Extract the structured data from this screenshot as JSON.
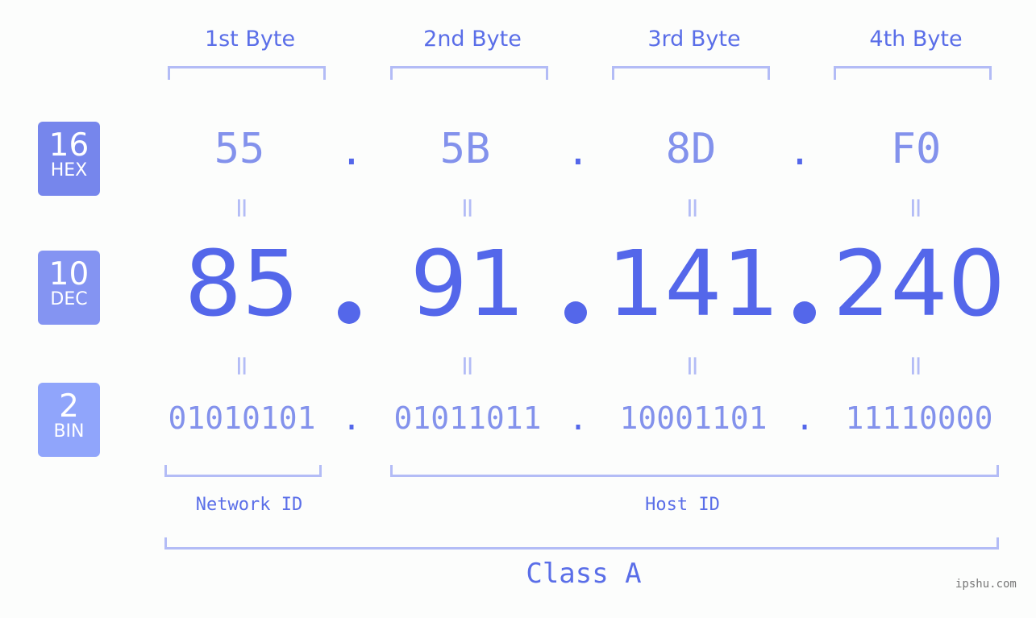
{
  "byte_headers": [
    "1st Byte",
    "2nd Byte",
    "3rd Byte",
    "4th Byte"
  ],
  "badges": [
    {
      "num": "16",
      "label": "HEX",
      "color": "#7686ec"
    },
    {
      "num": "10",
      "label": "DEC",
      "color": "#8494f2"
    },
    {
      "num": "2",
      "label": "BIN",
      "color": "#90a5fb"
    }
  ],
  "hex": [
    "55",
    "5B",
    "8D",
    "F0"
  ],
  "dec": [
    "85",
    "91",
    "141",
    "240"
  ],
  "bin": [
    "01010101",
    "01011011",
    "10001101",
    "11110000"
  ],
  "separator": ".",
  "equals": "=",
  "network_label": "Network ID",
  "host_label": "Host ID",
  "class_label": "Class A",
  "watermark": "ipshu.com"
}
